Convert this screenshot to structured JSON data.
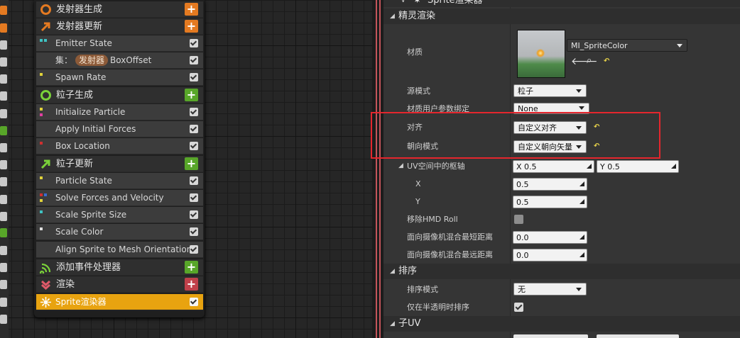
{
  "stack": {
    "rows": [
      {
        "label": "发射器生成",
        "kind": "header",
        "button": "+",
        "icon": "emitter-spawn-icon"
      },
      {
        "label": "发射器更新",
        "kind": "header",
        "button": "+",
        "icon": "emitter-update-icon"
      },
      {
        "label": "Emitter State",
        "kind": "module"
      },
      {
        "label": "BoxOffset",
        "kind": "module",
        "prefix": "集：",
        "pill": "发射器"
      },
      {
        "label": "Spawn Rate",
        "kind": "module"
      },
      {
        "label": "粒子生成",
        "kind": "header",
        "button": "+",
        "icon": "particle-spawn-icon"
      },
      {
        "label": "Initialize Particle",
        "kind": "module"
      },
      {
        "label": "Apply Initial Forces",
        "kind": "module"
      },
      {
        "label": "Box Location",
        "kind": "module"
      },
      {
        "label": "粒子更新",
        "kind": "header",
        "button": "+",
        "icon": "particle-update-icon"
      },
      {
        "label": "Particle State",
        "kind": "module"
      },
      {
        "label": "Solve Forces and Velocity",
        "kind": "module"
      },
      {
        "label": "Scale Sprite Size",
        "kind": "module"
      },
      {
        "label": "Scale Color",
        "kind": "module"
      },
      {
        "label": "Align Sprite to Mesh Orientation",
        "kind": "module"
      },
      {
        "label": "添加事件处理器",
        "kind": "header",
        "button": "+",
        "icon": "event-handler-icon"
      },
      {
        "label": "渲染",
        "kind": "header",
        "button": "+",
        "icon": "render-icon"
      },
      {
        "label": "Sprite渲染器",
        "kind": "selected"
      }
    ]
  },
  "details": {
    "title": "Sprite渲染器",
    "cat_sprite": "精灵渲染",
    "material_label": "材质",
    "material_value": "MI_SpriteColor",
    "source_mode_label": "源模式",
    "source_mode_value": "粒子",
    "material_binding_label": "材质用户参数绑定",
    "material_binding_value": "None",
    "alignment_label": "对齐",
    "alignment_value": "自定义对齐",
    "facing_label": "朝向模式",
    "facing_value": "自定义朝向矢量",
    "pivot_label": "UV空间中的枢轴",
    "pivot_x_text": "X  0.5",
    "pivot_y_text": "Y  0.5",
    "x_label": "X",
    "x_value": "0.5",
    "y_label": "Y",
    "y_value": "0.5",
    "remove_hmd_label": "移除HMD Roll",
    "min_blend_label": "面向摄像机混合最短距离",
    "min_blend_value": "0.0",
    "max_blend_label": "面向摄像机混合最远距离",
    "max_blend_value": "0.0",
    "cat_sort": "排序",
    "sort_mode_label": "排序模式",
    "sort_mode_value": "无",
    "sort_translucent_label": "仅在半透明时排序",
    "cat_subuv": "子UV"
  },
  "colors": {
    "accent_selected": "#e8a310",
    "add_orange": "#e47a21",
    "add_green": "#58a629",
    "add_red": "#c0404a",
    "highlight_box": "#e5262d"
  }
}
